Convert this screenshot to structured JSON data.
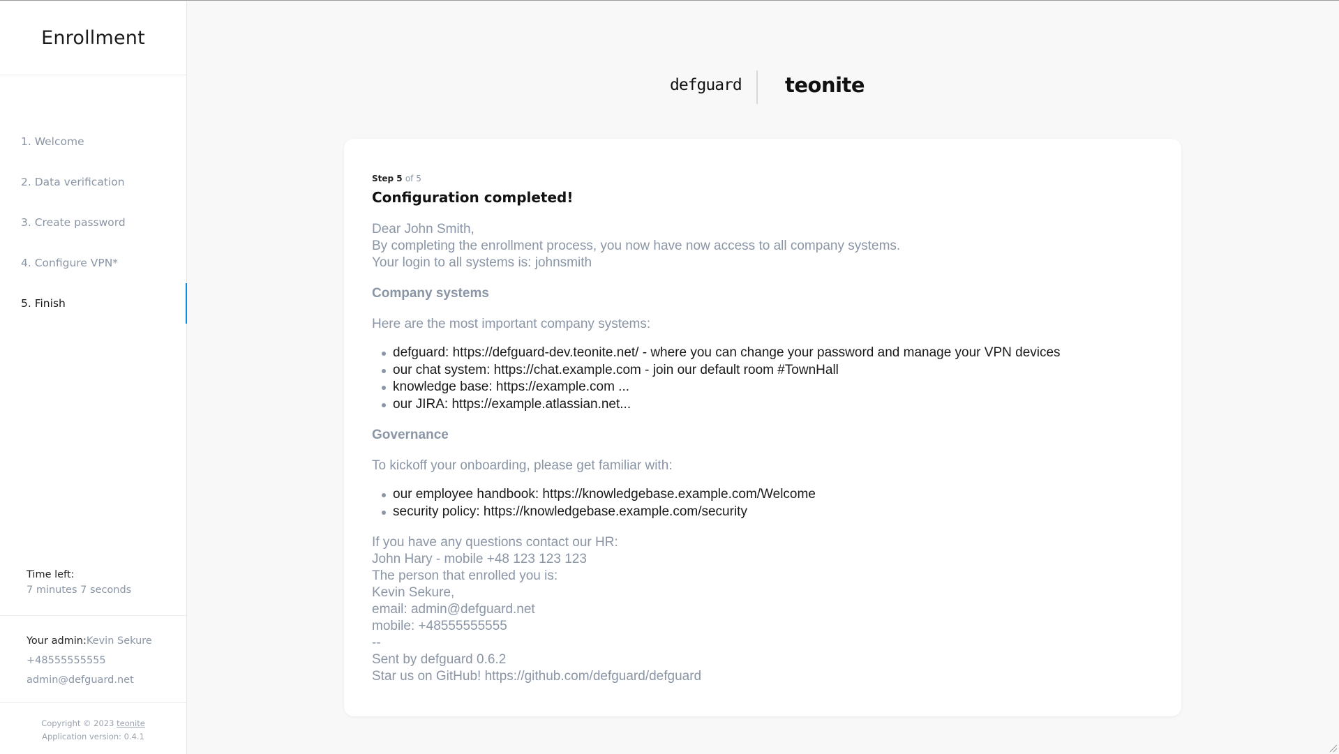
{
  "sidebar": {
    "title": "Enrollment",
    "steps": [
      {
        "label": "1. Welcome"
      },
      {
        "label": "2. Data verification"
      },
      {
        "label": "3. Create password"
      },
      {
        "label": "4. Configure VPN*"
      },
      {
        "label": "5. Finish"
      }
    ],
    "active_step": 5,
    "time_left_label": "Time left:",
    "time_left_value": "7 minutes 7 seconds",
    "admin_label": "Your admin:",
    "admin_name": "Kevin Sekure",
    "admin_phone": "+48555555555",
    "admin_email": "admin@defguard.net",
    "copyright_prefix": "Copyright © 2023",
    "copyright_link": "teonite",
    "app_version": "Application version: 0.4.1"
  },
  "logos": {
    "left": "defguard",
    "right": "teonite"
  },
  "card": {
    "step_label": "Step 5",
    "step_of": "of 5",
    "title": "Configuration completed!",
    "intro_lines": [
      "Dear John Smith,",
      "By completing the enrollment process, you now have now access to all company systems.",
      "Your login to all systems is: johnsmith"
    ],
    "systems_heading": "Company systems",
    "systems_intro": "Here are the most important company systems:",
    "systems": [
      "defguard: https://defguard-dev.teonite.net/ - where you can change your password and manage your VPN devices",
      "our chat system: https://chat.example.com - join our default room #TownHall",
      "knowledge base: https://example.com ...",
      "our JIRA: https://example.atlassian.net..."
    ],
    "governance_heading": "Governance",
    "governance_intro": "To kickoff your onboarding, please get familiar with:",
    "governance": [
      "our employee handbook: https://knowledgebase.example.com/Welcome",
      "security policy: https://knowledgebase.example.com/security"
    ],
    "closing_lines": [
      "If you have any questions contact our HR:",
      "John Hary - mobile +48 123 123 123",
      "The person that enrolled you is:",
      "Kevin Sekure,",
      "email: admin@defguard.net",
      "mobile: +48555555555",
      "--",
      "Sent by defguard 0.6.2",
      "Star us on GitHub! https://github.com/defguard/defguard"
    ]
  }
}
